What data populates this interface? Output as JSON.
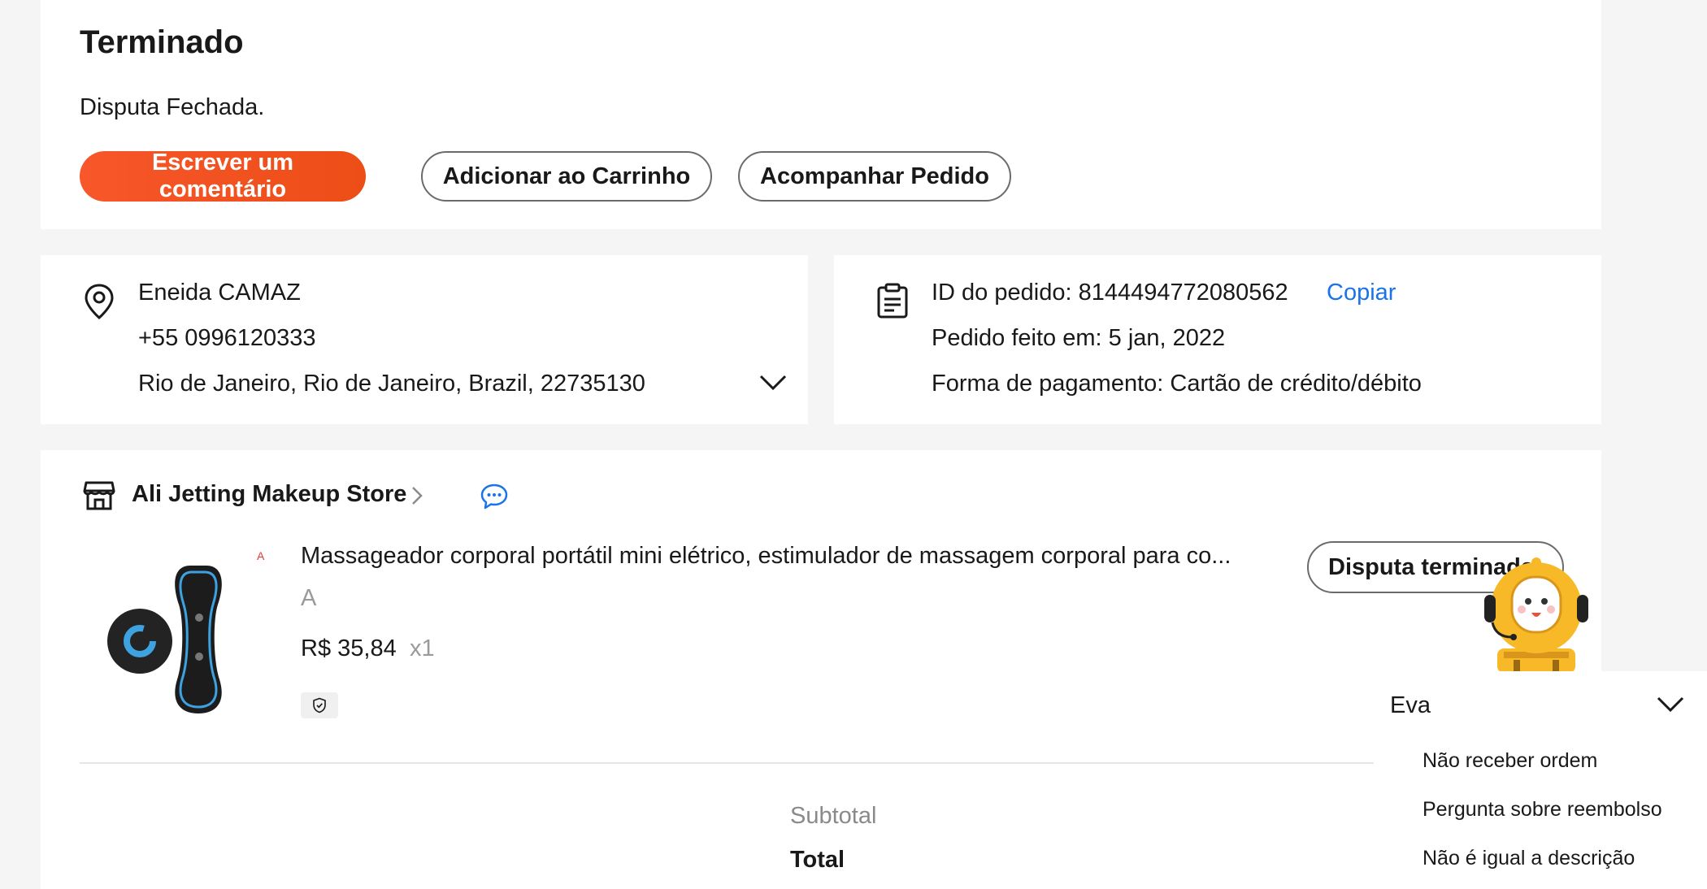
{
  "status": {
    "title": "Terminado",
    "description": "Disputa Fechada.",
    "buttons": {
      "review": "Escrever um comentário",
      "add_to_cart": "Adicionar ao Carrinho",
      "track_order": "Acompanhar Pedido"
    }
  },
  "address": {
    "name": "Eneida CAMAZ",
    "phone": "+55 0996120333",
    "location": "Rio de Janeiro, Rio de Janeiro, Brazil, 22735130"
  },
  "order": {
    "id_line": "ID do pedido: 8144494772080562",
    "copy_label": "Copiar",
    "placed_line": "Pedido feito em: 5 jan, 2022",
    "payment_line": "Forma de pagamento: Cartão de crédito/débito"
  },
  "store": {
    "name": "Ali Jetting Makeup Store"
  },
  "product": {
    "title": "Massageador corporal portátil mini elétrico, estimulador de massagem corporal para co...",
    "mark": "A",
    "variant": "A",
    "price": "R$ 35,84",
    "quantity": "x1",
    "dispute_button": "Disputa terminada"
  },
  "summary": {
    "subtotal_label": "Subtotal",
    "total_label": "Total"
  },
  "assistant": {
    "name": "Eva",
    "options": [
      "Não receber ordem",
      "Pergunta sobre reembolso",
      "Não é igual a descrição"
    ]
  },
  "colors": {
    "accent": "#f25a1e",
    "link": "#1a73e8",
    "background": "#f5f5f5",
    "mascot_yellow": "#f7b928"
  },
  "icons": [
    "location-pin-icon",
    "order-document-icon",
    "store-icon",
    "chevron-right-icon",
    "chat-bubble-icon",
    "chevron-down-icon",
    "shield-check-icon"
  ]
}
